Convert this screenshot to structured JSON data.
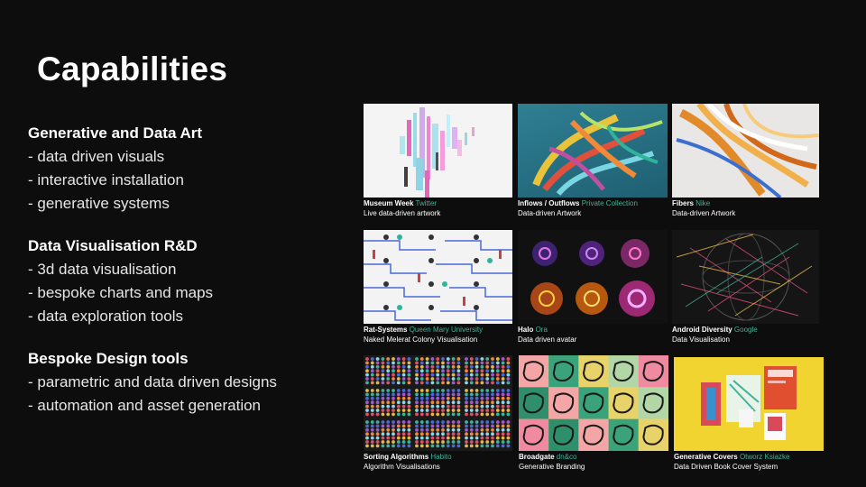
{
  "title": "Capabilities",
  "sections": [
    {
      "heading": "Generative and Data Art",
      "items": [
        "- data driven visuals",
        "- interactive installation",
        "- generative systems"
      ]
    },
    {
      "heading": "Data Visualisation R&D",
      "items": [
        "- 3d data visualisation",
        "- bespoke charts and maps",
        "- data exploration tools"
      ]
    },
    {
      "heading": "Bespoke Design tools",
      "items": [
        "- parametric and data driven designs",
        "- automation and asset generation"
      ]
    }
  ],
  "projects": [
    {
      "name": "Museum Week",
      "client": "Twitter",
      "subtitle": "Live data-driven artwork"
    },
    {
      "name": "Inflows / Outflows",
      "client": "Private Collection",
      "subtitle": "Data-driven Artwork"
    },
    {
      "name": "Fibers",
      "client": "Nike",
      "subtitle": "Data-driven Artwork"
    },
    {
      "name": "Rat-Systems",
      "client": "Queen Mary University",
      "subtitle": "Naked Melerat Colony Visualisation"
    },
    {
      "name": "Halo",
      "client": "Ora",
      "subtitle": "Data driven avatar"
    },
    {
      "name": "Android Diversity",
      "client": "Google",
      "subtitle": "Data Visualisation"
    },
    {
      "name": "Sorting Algorithms",
      "client": "Habito",
      "subtitle": "Algorithm Visualisations"
    },
    {
      "name": "Broadgate",
      "client": "dn&co",
      "subtitle": "Generative Branding"
    },
    {
      "name": "Generative Covers",
      "client": "Otworz Ksiazke",
      "subtitle": "Data Driven Book Cover System"
    }
  ],
  "colors": {
    "accent": "#3fb39a",
    "background": "#0d0d0d"
  }
}
